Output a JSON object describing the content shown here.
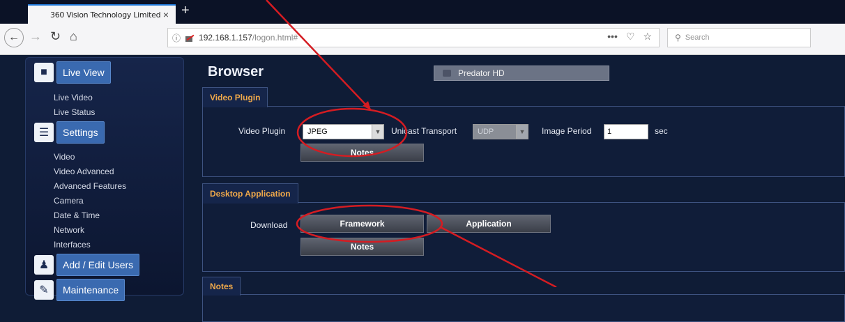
{
  "browser": {
    "tab_title": "360 Vision Technology Limited",
    "tab_close": "×",
    "new_tab": "+",
    "url_host": "192.168.1.157",
    "url_path": "/logon.html#",
    "search_placeholder": "Search",
    "url_menu": "•••"
  },
  "sidebar": {
    "sections": [
      {
        "label": "Live View",
        "icon": "video-camera-icon"
      },
      {
        "label": "Settings",
        "icon": "settings-sliders-icon"
      },
      {
        "label": "Add / Edit Users",
        "icon": "add-user-icon"
      },
      {
        "label": "Maintenance",
        "icon": "wrench-icon"
      }
    ],
    "live_view_items": [
      "Live Video",
      "Live Status"
    ],
    "settings_items": [
      "Video",
      "Video Advanced",
      "Advanced Features",
      "Camera",
      "Date & Time",
      "Network",
      "Interfaces"
    ]
  },
  "main": {
    "title": "Browser",
    "camera_name": "Predator HD",
    "video_plugin_group": {
      "tab": "Video Plugin",
      "plugin_label": "Video Plugin",
      "plugin_value": "JPEG",
      "transport_label": "Unicast Transport",
      "transport_value": "UDP",
      "period_label": "Image Period",
      "period_value": "1",
      "period_unit": "sec",
      "notes_button": "Notes"
    },
    "desktop_group": {
      "tab": "Desktop Application",
      "download_label": "Download",
      "framework_button": "Framework",
      "application_button": "Application",
      "notes_button": "Notes"
    },
    "notes_group": {
      "tab": "Notes"
    }
  },
  "colors": {
    "page_bg": "#0f1c36",
    "accent_orange": "#f0a94a",
    "annotation_red": "#d41c22",
    "sidebar_section_bg": "#3a6ab0"
  }
}
